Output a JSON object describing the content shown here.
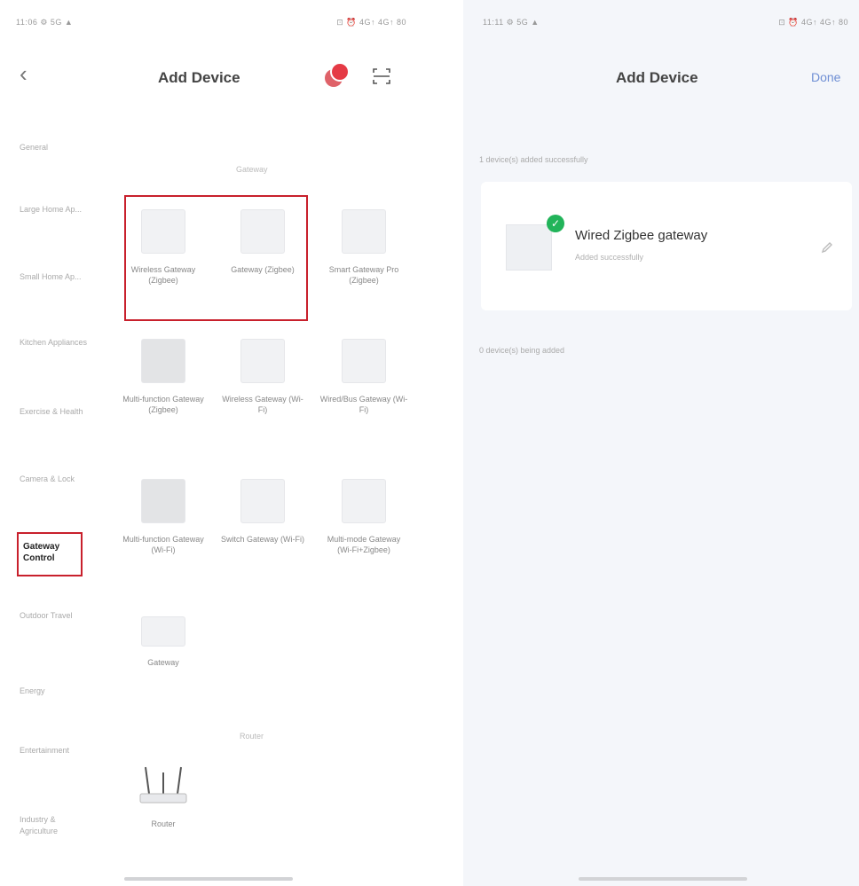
{
  "left": {
    "status_left": "11:06 ⚙ 5G ▲",
    "status_right": "⊡ ⏰ 4G↑ 4G↑ 80",
    "title": "Add Device",
    "categories": [
      "General",
      "Large Home Ap...",
      "Small Home Ap...",
      "Kitchen Appliances",
      "Exercise & Health",
      "Camera & Lock",
      "Gateway Control",
      "Outdoor Travel",
      "Energy",
      "Entertainment",
      "Industry & Agriculture"
    ],
    "sections": {
      "zigbee": "Gateway",
      "router": "Router"
    },
    "devices": [
      "Wireless Gateway (Zigbee)",
      "Gateway (Zigbee)",
      "Smart Gateway Pro (Zigbee)",
      "Multi-function Gateway (Zigbee)",
      "Wireless Gateway (Wi-Fi)",
      "Wired/Bus Gateway (Wi-Fi)",
      "Multi-function Gateway (Wi-Fi)",
      "Switch Gateway (Wi-Fi)",
      "Multi-mode Gateway (Wi-Fi+Zigbee)",
      "Gateway",
      "Router"
    ],
    "router_tag": "Router"
  },
  "right": {
    "status_left": "11:11 ⚙ 5G ▲",
    "status_right": "⊡ ⏰ 4G↑ 4G↑ 80",
    "title": "Add Device",
    "done": "Done",
    "added_label": "1 device(s) added successfully",
    "device_name": "Wired Zigbee gateway",
    "device_sub": "Added successfully",
    "pending_label": "0 device(s) being added"
  },
  "colors": {
    "highlight": "#c8202c",
    "accent": "#6f8fd4",
    "success": "#22b45a",
    "badge": "#e53a45"
  }
}
